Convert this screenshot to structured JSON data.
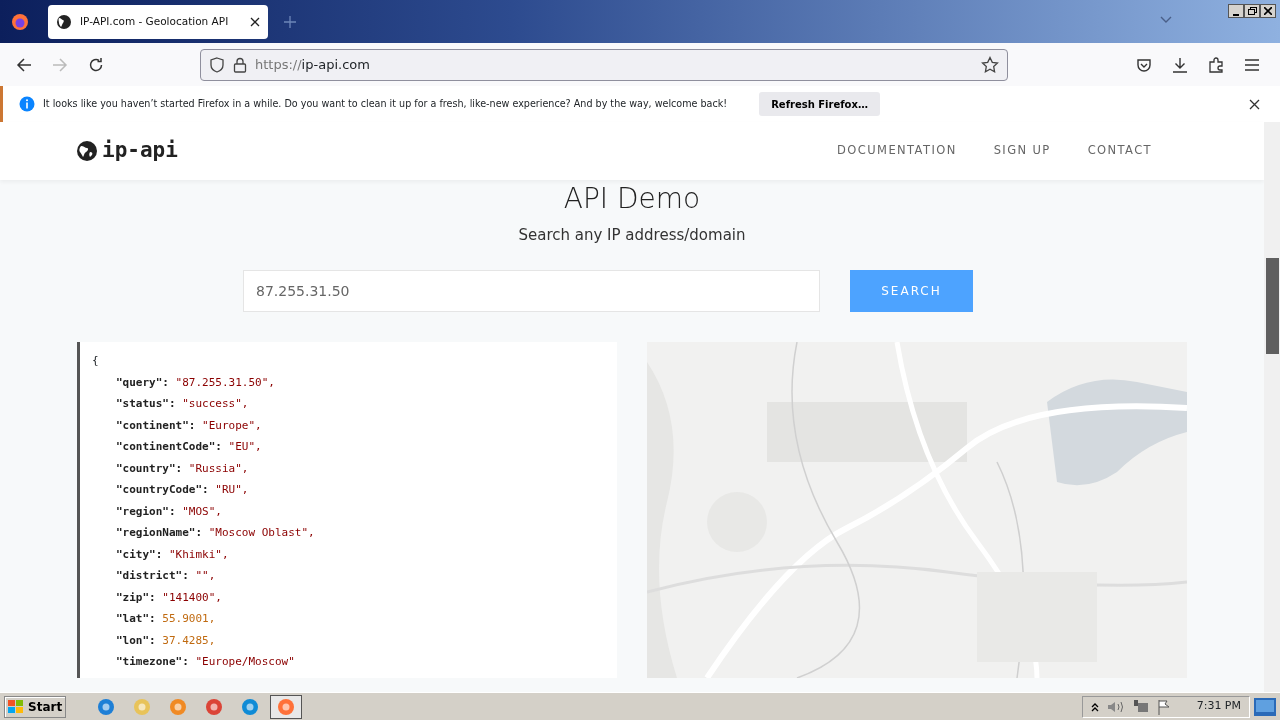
{
  "browser": {
    "tabs": [
      {
        "title": "IP-API.com - Geolocation API",
        "selected": true
      }
    ],
    "url": {
      "scheme": "https://",
      "host": "ip-api.com"
    },
    "notification": {
      "message": "It looks like you haven’t started Firefox in a while. Do you want to clean it up for a fresh, like-new experience? And by the way, welcome back!",
      "button": "Refresh Firefox…"
    }
  },
  "site": {
    "logo": "ip-api",
    "nav": [
      "DOCUMENTATION",
      "SIGN UP",
      "CONTACT"
    ],
    "title": "API Demo",
    "subtitle": "Search any IP address/domain",
    "search": {
      "value": "87.255.31.50",
      "button": "SEARCH"
    },
    "response": {
      "open": "{",
      "lines": [
        {
          "key": "\"query\": ",
          "value": "\"87.255.31.50\",",
          "kind": "string"
        },
        {
          "key": "\"status\": ",
          "value": "\"success\",",
          "kind": "string"
        },
        {
          "key": "\"continent\": ",
          "value": "\"Europe\",",
          "kind": "string"
        },
        {
          "key": "\"continentCode\": ",
          "value": "\"EU\",",
          "kind": "string"
        },
        {
          "key": "\"country\": ",
          "value": "\"Russia\",",
          "kind": "string"
        },
        {
          "key": "\"countryCode\": ",
          "value": "\"RU\",",
          "kind": "string"
        },
        {
          "key": "\"region\": ",
          "value": "\"MOS\",",
          "kind": "string"
        },
        {
          "key": "\"regionName\": ",
          "value": "\"Moscow Oblast\",",
          "kind": "string"
        },
        {
          "key": "\"city\": ",
          "value": "\"Khimki\",",
          "kind": "string"
        },
        {
          "key": "\"district\": ",
          "value": "\"\",",
          "kind": "string"
        },
        {
          "key": "\"zip\": ",
          "value": "\"141400\",",
          "kind": "string"
        },
        {
          "key": "\"lat\": ",
          "value": "55.9001,",
          "kind": "number"
        },
        {
          "key": "\"lon\": ",
          "value": "37.4285,",
          "kind": "number"
        },
        {
          "key": "\"timezone\": ",
          "value": "\"Europe/Moscow\"",
          "kind": "string"
        }
      ]
    }
  },
  "taskbar": {
    "start": "Start",
    "apps": [
      {
        "kind": "ie",
        "selected": false
      },
      {
        "kind": "folder",
        "selected": false
      },
      {
        "kind": "media",
        "selected": false
      },
      {
        "kind": "chrome",
        "selected": false
      },
      {
        "kind": "edge",
        "selected": false
      },
      {
        "kind": "firefox",
        "selected": true
      }
    ],
    "time": "7:31 PM"
  }
}
